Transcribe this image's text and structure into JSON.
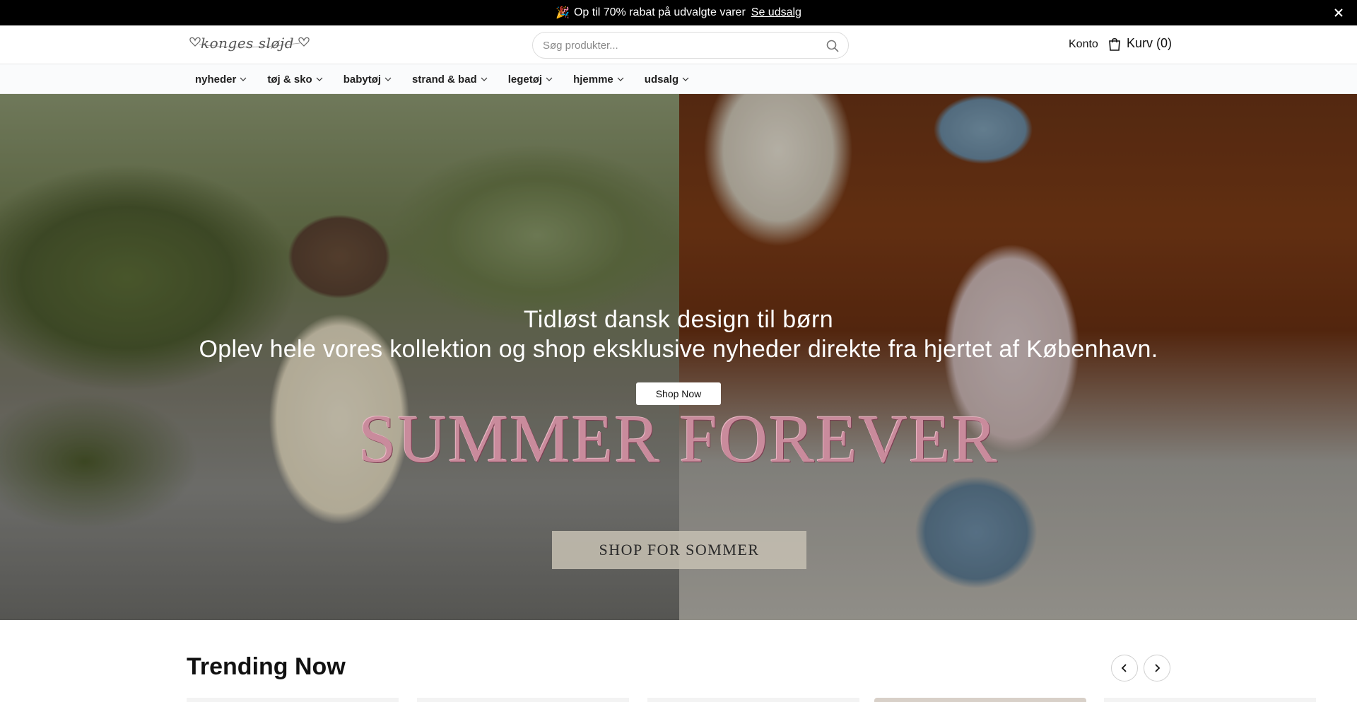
{
  "announcement": {
    "emoji": "🎉",
    "text": "Op til 70% rabat på udvalgte varer",
    "link_label": "Se udsalg",
    "close_icon": "close-icon"
  },
  "header": {
    "logo_text": "konges sløjd",
    "search_placeholder": "Søg produkter...",
    "account_label": "Konto",
    "cart_label": "Kurv (0)"
  },
  "nav": {
    "items": [
      {
        "label": "nyheder"
      },
      {
        "label": "tøj & sko"
      },
      {
        "label": "babytøj"
      },
      {
        "label": "strand & bad"
      },
      {
        "label": "legetøj"
      },
      {
        "label": "hjemme"
      },
      {
        "label": "udsalg"
      }
    ]
  },
  "hero": {
    "title": "Tidløst dansk design til børn",
    "subtitle": "Oplev hele vores kollektion og shop eksklusive nyheder direkte fra hjertet af København.",
    "button_label": "Shop Now",
    "big_text": "SUMMER FOREVER",
    "cta_label": "SHOP FOR SOMMER"
  },
  "trending": {
    "title": "Trending Now"
  }
}
